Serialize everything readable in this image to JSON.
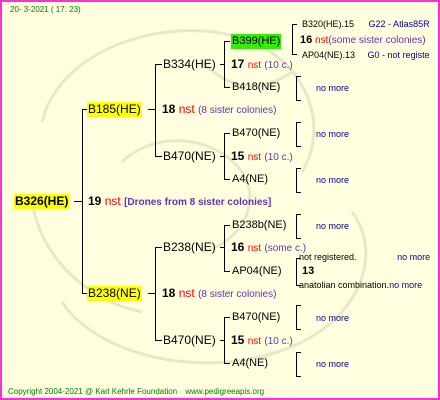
{
  "header": {
    "date": "20-  3-2021  ( 17: 23)"
  },
  "colors": {
    "frame": "#ff2fd0",
    "background": "#ffffe0",
    "highlight": "#ffff00",
    "green_highlight": "#33ee00",
    "nst": "#ff0000",
    "sisters": "#6633aa"
  },
  "root": {
    "name": "B326(HE)",
    "gen_num": "19",
    "gen_nst": "nst",
    "gen_note": "[Drones from 8 sister colonies]"
  },
  "father": {
    "name": "B185(HE)",
    "gen_num": "18",
    "gen_nst": "nst",
    "gen_note": "(8 sister colonies)"
  },
  "mother": {
    "name": "B238(NE)",
    "gen_num": "18",
    "gen_nst": "nst",
    "gen_note": "(8 sister colonies)"
  },
  "ff": {
    "name": "B334(HE)",
    "gen_num": "17",
    "gen_nst": "nst",
    "gen_note": "(10 c.)"
  },
  "fm": {
    "name": "B470(NE)",
    "gen_num": "15",
    "gen_nst": "nst",
    "gen_note": "(10 c.)"
  },
  "mf": {
    "name": "B238(NE)",
    "gen_num": "16",
    "gen_nst": "nst",
    "gen_note": "(some c.)"
  },
  "mm": {
    "name": "B470(NE)",
    "gen_num": "15",
    "gen_nst": "nst",
    "gen_note": "(10 c.)"
  },
  "fff": {
    "name": "B399(HE)",
    "gen_num": "16",
    "gen_nst": "nst",
    "gen_note": "(some sister colonies)"
  },
  "ffm": {
    "name": "B418(NE)",
    "no_more": "no more"
  },
  "fmf": {
    "name": "B470(NE)",
    "no_more": "no more"
  },
  "fmm": {
    "name": "A4(NE)",
    "no_more": "no more"
  },
  "mff": {
    "name": "B238b(NE)",
    "no_more": "no more"
  },
  "mfm": {
    "name": "AP04(NE)",
    "gen_num": "13"
  },
  "mmf": {
    "name": "B470(NE)",
    "no_more": "no more"
  },
  "mmm": {
    "name": "A4(NE)",
    "no_more": "no more"
  },
  "g4": {
    "ffff": {
      "name": "B320(HE).15",
      "extra": "G22 - Atlas85R"
    },
    "fffm": {
      "name": "AP04(NE).13",
      "extra": "G0 - not registe"
    },
    "mfff": {
      "name": "not registered.",
      "no_more": "no more"
    },
    "mffm": {
      "name": "anatolian combination.",
      "no_more": "no more"
    }
  },
  "footer": {
    "copyright": "Copyright 2004-2021 @ Karl Kehrle Foundation",
    "site": "www.pedigreeapis.org"
  }
}
